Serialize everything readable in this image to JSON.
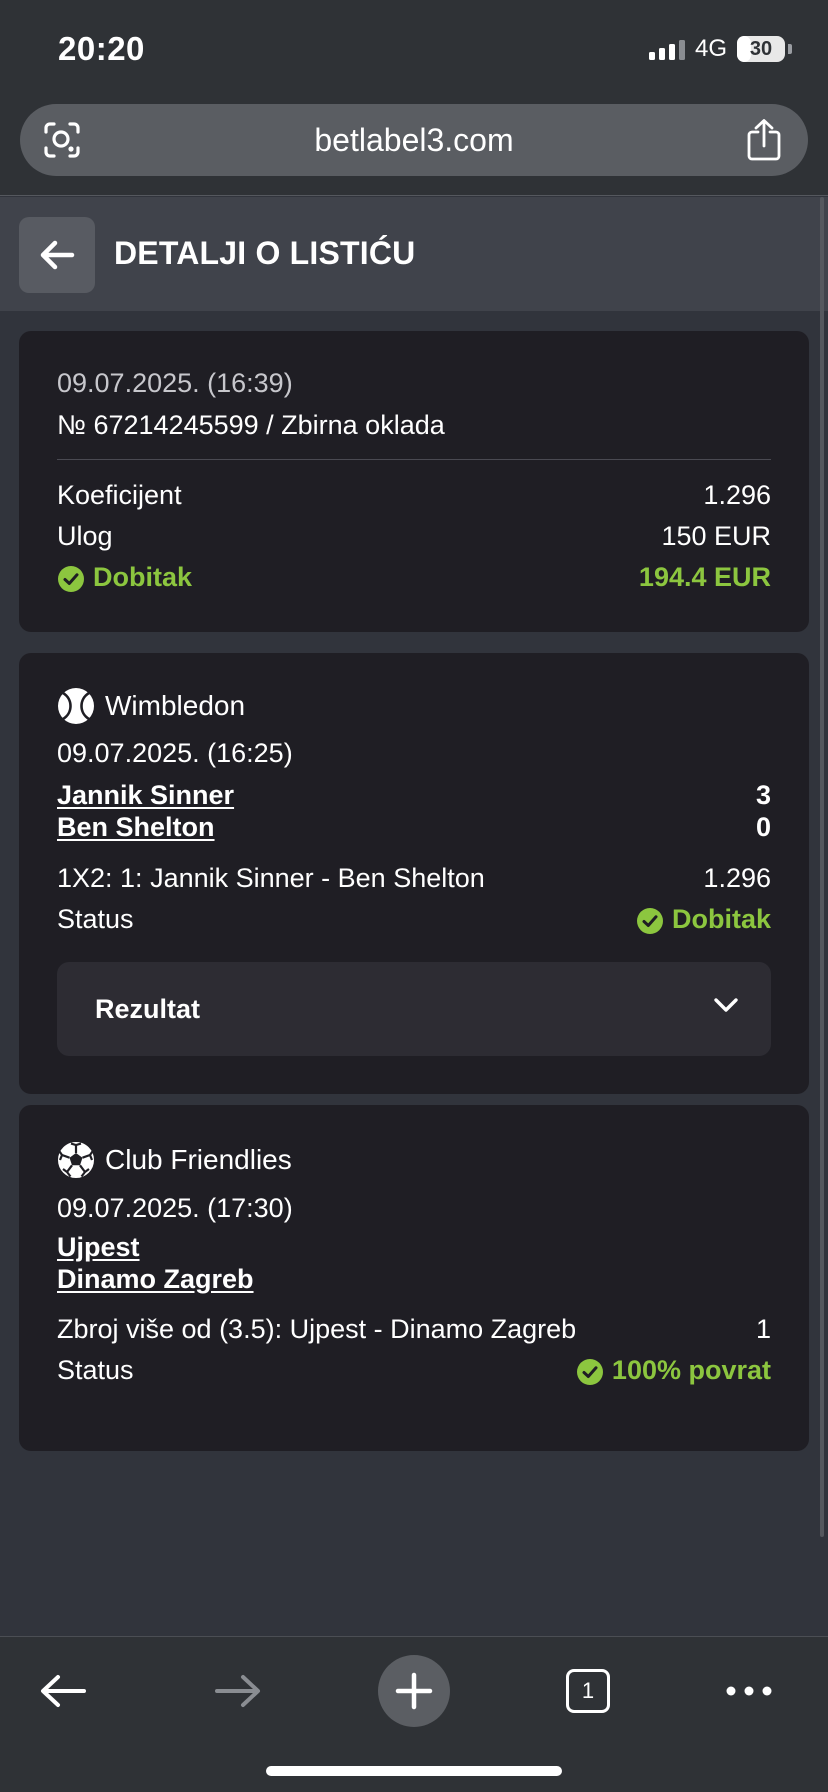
{
  "status_bar": {
    "time": "20:20",
    "network": "4G",
    "battery": "30",
    "battery_level": 0.3
  },
  "browser": {
    "url": "betlabel3.com",
    "left_icon": "lens-icon",
    "share_icon": "share-icon"
  },
  "header": {
    "title": "DETALJI O LISTIĆU",
    "back_icon": "arrow-left-icon"
  },
  "summary": {
    "date": "09.07.2025. (16:39)",
    "ticket": "№ 67214245599 / Zbirna oklada",
    "odds_label": "Koeficijent",
    "odds_value": "1.296",
    "stake_label": "Ulog",
    "stake_value": "150 EUR",
    "win_label": "Dobitak",
    "win_value": "194.4 EUR"
  },
  "events": [
    {
      "sport_icon": "tennis-ball-icon",
      "league": "Wimbledon",
      "date": "09.07.2025. (16:25)",
      "team1": "Jannik Sinner",
      "score1": "3",
      "team2": "Ben Shelton",
      "score2": "0",
      "market": "1X2: 1: Jannik Sinner - Ben Shelton",
      "market_odds": "1.296",
      "status_label": "Status",
      "status_value": "Dobitak",
      "result_label": "Rezultat"
    },
    {
      "sport_icon": "soccer-ball-icon",
      "league": "Club Friendlies",
      "date": "09.07.2025. (17:30)",
      "team1": "Ujpest",
      "team2": "Dinamo Zagreb",
      "market": "Zbroj više od (3.5): Ujpest - Dinamo Zagreb",
      "market_odds": "1",
      "status_label": "Status",
      "status_value": "100% povrat"
    }
  ],
  "toolbar": {
    "tab_count": "1",
    "icons": [
      "back-arrow-icon",
      "forward-arrow-icon",
      "plus-icon",
      "tabs-icon",
      "more-icon"
    ]
  },
  "colors": {
    "accent_green": "#8cc63f",
    "card_bg": "#1f1e24",
    "page_bg": "#31343c"
  }
}
